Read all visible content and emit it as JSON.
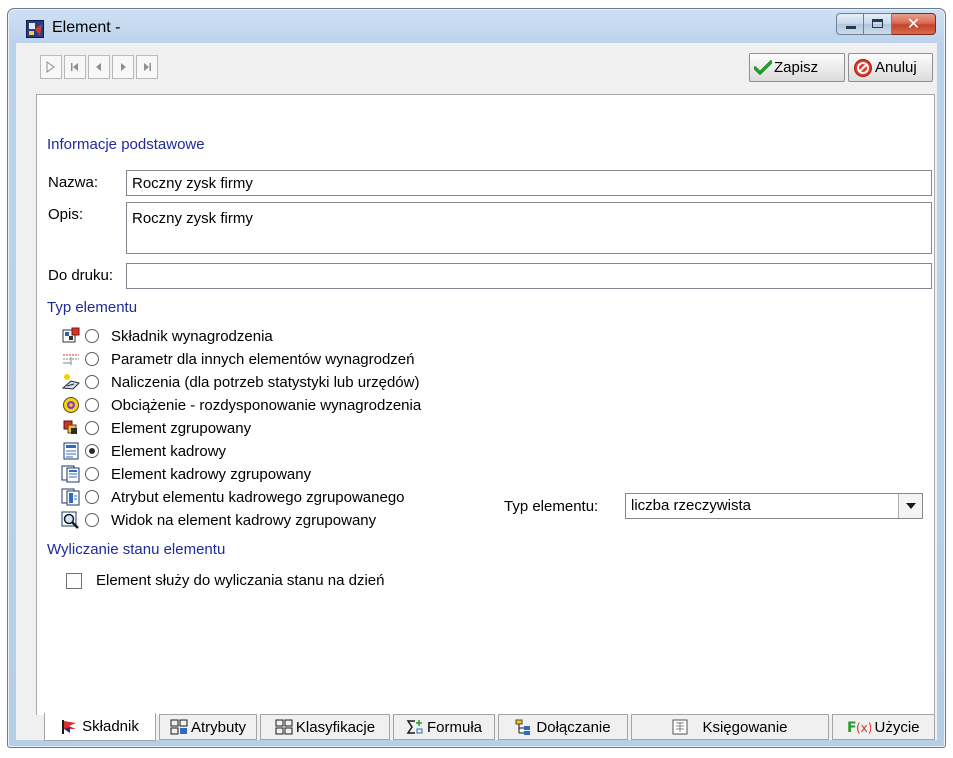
{
  "window": {
    "title": "Element -"
  },
  "toolbar": {
    "save_label": "Zapisz",
    "cancel_label": "Anuluj"
  },
  "basic": {
    "section_title": "Informacje podstawowe",
    "name_label": "Nazwa:",
    "name_value": "Roczny zysk firmy",
    "desc_label": "Opis:",
    "desc_value": "Roczny zysk firmy",
    "print_label": "Do druku:",
    "print_value": ""
  },
  "element_type": {
    "section_title": "Typ elementu",
    "options": [
      {
        "label": "Składnik wynagrodzenia",
        "icon": "salary-component-icon",
        "selected": false
      },
      {
        "label": "Parametr dla innych elementów wynagrodzeń",
        "icon": "parameter-icon",
        "selected": false
      },
      {
        "label": "Naliczenia (dla potrzeb statystyki lub urzędów)",
        "icon": "accrual-icon",
        "selected": false
      },
      {
        "label": "Obciążenie - rozdysponowanie wynagrodzenia",
        "icon": "burden-icon",
        "selected": false
      },
      {
        "label": "Element zgrupowany",
        "icon": "grouped-element-icon",
        "selected": false
      },
      {
        "label": "Element kadrowy",
        "icon": "hr-element-icon",
        "selected": true
      },
      {
        "label": "Element kadrowy zgrupowany",
        "icon": "hr-grouped-icon",
        "selected": false
      },
      {
        "label": "Atrybut elementu kadrowego zgrupowanego",
        "icon": "hr-attribute-icon",
        "selected": false
      },
      {
        "label": "Widok na element kadrowy zgrupowany",
        "icon": "hr-view-icon",
        "selected": false
      }
    ],
    "type_label": "Typ elementu:",
    "type_value": "liczba rzeczywista"
  },
  "state": {
    "section_title": "Wyliczanie stanu elementu",
    "checkbox_label": "Element służy do wyliczania stanu na dzień",
    "checked": false
  },
  "tabs": [
    {
      "label": "Składnik",
      "icon": "flag-icon",
      "active": true
    },
    {
      "label": "Atrybuty",
      "icon": "attributes-icon",
      "active": false
    },
    {
      "label": "Klasyfikacje",
      "icon": "classification-icon",
      "active": false
    },
    {
      "label": "Formuła",
      "icon": "formula-icon",
      "active": false
    },
    {
      "label": "Dołączanie",
      "icon": "attach-icon",
      "active": false
    },
    {
      "label": "Księgowanie",
      "icon": "accounting-icon",
      "active": false
    },
    {
      "label": "Użycie",
      "icon": "usage-icon",
      "active": false
    }
  ]
}
